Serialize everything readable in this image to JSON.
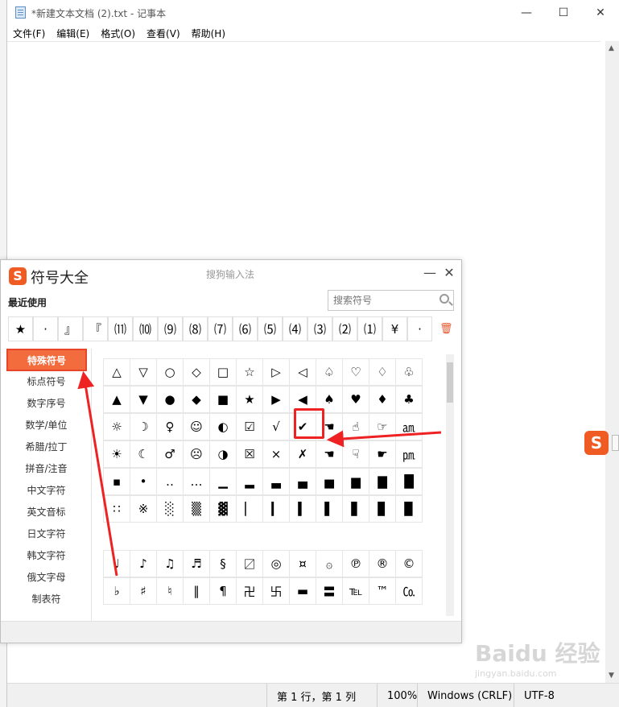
{
  "notepad": {
    "title": "*新建文本文档 (2).txt - 记事本",
    "window_buttons": [
      "—",
      "☐",
      "✕"
    ],
    "menu": [
      "文件(F)",
      "编辑(E)",
      "格式(O)",
      "查看(V)",
      "帮助(H)"
    ],
    "status": {
      "position": "第 1 行，第 1 列",
      "zoom": "100%",
      "line_ending": "Windows (CRLF)",
      "encoding": "UTF-8"
    }
  },
  "sogou": {
    "logo": "S",
    "title": "符号大全",
    "brand": "搜狗输入法",
    "minimize": "—",
    "close": "✕",
    "recent_label": "最近使用",
    "search_placeholder": "搜索符号",
    "recent": [
      "★",
      "·",
      "』",
      "『",
      "⑾",
      "⑽",
      "⑼",
      "⑻",
      "⑺",
      "⑹",
      "⑸",
      "⑷",
      "⑶",
      "⑵",
      "⑴",
      "¥",
      "·"
    ],
    "trash_icon": "trash-icon",
    "categories": [
      "特殊符号",
      "标点符号",
      "数字序号",
      "数学/单位",
      "希腊/拉丁",
      "拼音/注音",
      "中文字符",
      "英文音标",
      "日文字符",
      "韩文字符",
      "俄文字母",
      "制表符"
    ],
    "active_category": "特殊符号",
    "grid_block1": [
      [
        "△",
        "▽",
        "○",
        "◇",
        "□",
        "☆",
        "▷",
        "◁",
        "♤",
        "♡",
        "♢",
        "♧"
      ],
      [
        "▲",
        "▼",
        "●",
        "◆",
        "■",
        "★",
        "▶",
        "◀",
        "♠",
        "♥",
        "♦",
        "♣"
      ],
      [
        "☼",
        "☽",
        "♀",
        "☺",
        "◐",
        "☑",
        "√",
        "✔",
        "☚",
        "☝",
        "☞",
        "㏂"
      ],
      [
        "☀",
        "☾",
        "♂",
        "☹",
        "◑",
        "☒",
        "×",
        "✗",
        "☚",
        "☟",
        "☛",
        "㏘"
      ],
      [
        "▪",
        "•",
        "‥",
        "…",
        "▁",
        "▂",
        "▃",
        "▄",
        "▅",
        "▆",
        "▇",
        "█"
      ],
      [
        "∷",
        "※",
        "░",
        "▒",
        "▓",
        "▏",
        "▎",
        "▍",
        "▌",
        "▋",
        "▊",
        "▉"
      ]
    ],
    "grid_block2": [
      [
        "♩",
        "♪",
        "♫",
        "♬",
        "§",
        "〼",
        "◎",
        "¤",
        "۞",
        "℗",
        "®",
        "©"
      ],
      [
        "♭",
        "♯",
        "♮",
        "‖",
        "¶",
        "卍",
        "卐",
        "▬",
        "〓",
        "℡",
        "™",
        "㏇"
      ]
    ]
  },
  "watermark": {
    "main": "Baidu 经验",
    "sub": "jingyan.baidu.com"
  },
  "colors": {
    "accent": "#f36c3d",
    "highlight_red": "#e22222",
    "sogou_orange": "#f05a23"
  }
}
